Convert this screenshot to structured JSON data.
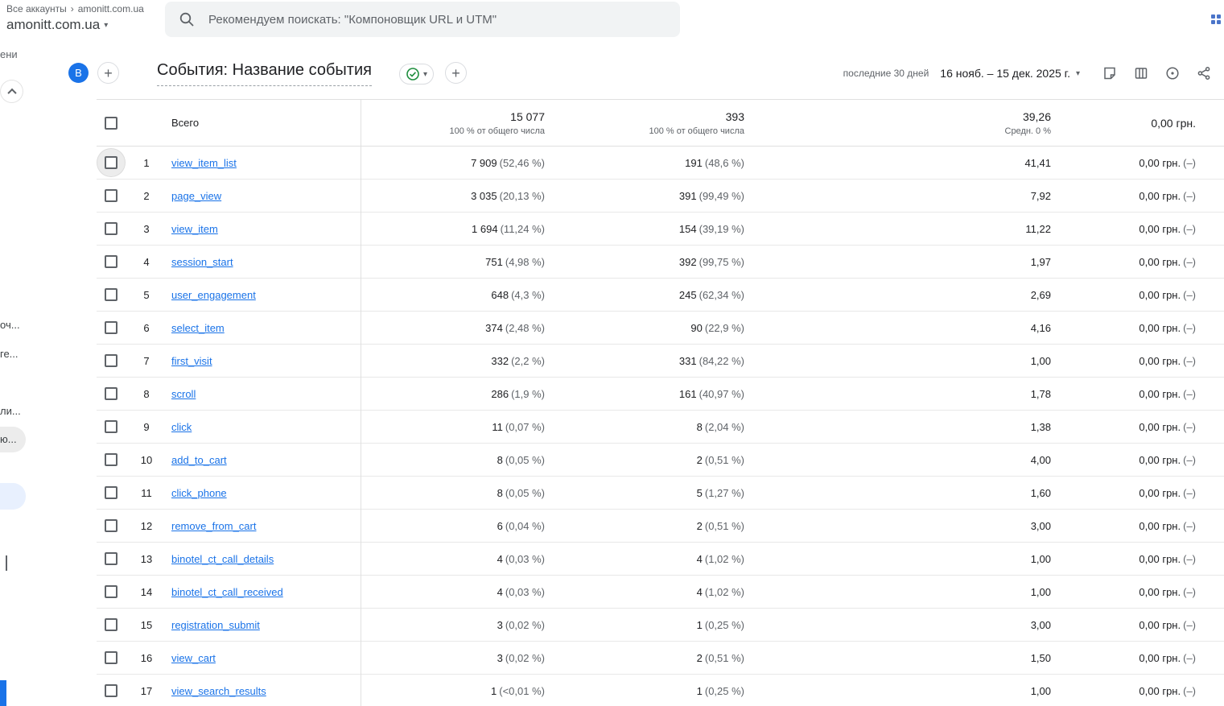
{
  "topbar": {
    "breadcrumb": {
      "root": "Все аккаунты",
      "current": "amonitt.com.ua"
    },
    "account_selector": "amonitt.com.ua",
    "search_placeholder": "Рекомендуем поискать: \"Компоновщик URL и UTM\""
  },
  "sidebar": {
    "fragments": [
      "ени",
      "оч...",
      "ге...",
      "ли...",
      "ю..."
    ]
  },
  "report_header": {
    "avatar_letter": "B",
    "title": "События: Название события",
    "date_range_label": "последние 30 дней",
    "date_range": "16 нояб. – 15 дек. 2025 г."
  },
  "table": {
    "totals": {
      "label": "Всего",
      "count": "15 077",
      "count_sub": "100 % от общего числа",
      "users": "393",
      "users_sub": "100 % от общего числа",
      "per_user": "39,26",
      "per_user_sub": "Средн. 0 %",
      "revenue": "0,00 грн."
    },
    "rows": [
      {
        "n": 1,
        "name": "view_item_list",
        "count": "7 909",
        "count_pct": "(52,46 %)",
        "users": "191",
        "users_pct": "(48,6 %)",
        "per_user": "41,41",
        "revenue": "0,00 грн.",
        "revenue_note": "(–)",
        "focused": true
      },
      {
        "n": 2,
        "name": "page_view",
        "count": "3 035",
        "count_pct": "(20,13 %)",
        "users": "391",
        "users_pct": "(99,49 %)",
        "per_user": "7,92",
        "revenue": "0,00 грн.",
        "revenue_note": "(–)"
      },
      {
        "n": 3,
        "name": "view_item",
        "count": "1 694",
        "count_pct": "(11,24 %)",
        "users": "154",
        "users_pct": "(39,19 %)",
        "per_user": "11,22",
        "revenue": "0,00 грн.",
        "revenue_note": "(–)"
      },
      {
        "n": 4,
        "name": "session_start",
        "count": "751",
        "count_pct": "(4,98 %)",
        "users": "392",
        "users_pct": "(99,75 %)",
        "per_user": "1,97",
        "revenue": "0,00 грн.",
        "revenue_note": "(–)"
      },
      {
        "n": 5,
        "name": "user_engagement",
        "count": "648",
        "count_pct": "(4,3 %)",
        "users": "245",
        "users_pct": "(62,34 %)",
        "per_user": "2,69",
        "revenue": "0,00 грн.",
        "revenue_note": "(–)"
      },
      {
        "n": 6,
        "name": "select_item",
        "count": "374",
        "count_pct": "(2,48 %)",
        "users": "90",
        "users_pct": "(22,9 %)",
        "per_user": "4,16",
        "revenue": "0,00 грн.",
        "revenue_note": "(–)"
      },
      {
        "n": 7,
        "name": "first_visit",
        "count": "332",
        "count_pct": "(2,2 %)",
        "users": "331",
        "users_pct": "(84,22 %)",
        "per_user": "1,00",
        "revenue": "0,00 грн.",
        "revenue_note": "(–)"
      },
      {
        "n": 8,
        "name": "scroll",
        "count": "286",
        "count_pct": "(1,9 %)",
        "users": "161",
        "users_pct": "(40,97 %)",
        "per_user": "1,78",
        "revenue": "0,00 грн.",
        "revenue_note": "(–)"
      },
      {
        "n": 9,
        "name": "click",
        "count": "11",
        "count_pct": "(0,07 %)",
        "users": "8",
        "users_pct": "(2,04 %)",
        "per_user": "1,38",
        "revenue": "0,00 грн.",
        "revenue_note": "(–)"
      },
      {
        "n": 10,
        "name": "add_to_cart",
        "count": "8",
        "count_pct": "(0,05 %)",
        "users": "2",
        "users_pct": "(0,51 %)",
        "per_user": "4,00",
        "revenue": "0,00 грн.",
        "revenue_note": "(–)"
      },
      {
        "n": 11,
        "name": "click_phone",
        "count": "8",
        "count_pct": "(0,05 %)",
        "users": "5",
        "users_pct": "(1,27 %)",
        "per_user": "1,60",
        "revenue": "0,00 грн.",
        "revenue_note": "(–)"
      },
      {
        "n": 12,
        "name": "remove_from_cart",
        "count": "6",
        "count_pct": "(0,04 %)",
        "users": "2",
        "users_pct": "(0,51 %)",
        "per_user": "3,00",
        "revenue": "0,00 грн.",
        "revenue_note": "(–)"
      },
      {
        "n": 13,
        "name": "binotel_ct_call_details",
        "count": "4",
        "count_pct": "(0,03 %)",
        "users": "4",
        "users_pct": "(1,02 %)",
        "per_user": "1,00",
        "revenue": "0,00 грн.",
        "revenue_note": "(–)"
      },
      {
        "n": 14,
        "name": "binotel_ct_call_received",
        "count": "4",
        "count_pct": "(0,03 %)",
        "users": "4",
        "users_pct": "(1,02 %)",
        "per_user": "1,00",
        "revenue": "0,00 грн.",
        "revenue_note": "(–)"
      },
      {
        "n": 15,
        "name": "registration_submit",
        "count": "3",
        "count_pct": "(0,02 %)",
        "users": "1",
        "users_pct": "(0,25 %)",
        "per_user": "3,00",
        "revenue": "0,00 грн.",
        "revenue_note": "(–)"
      },
      {
        "n": 16,
        "name": "view_cart",
        "count": "3",
        "count_pct": "(0,02 %)",
        "users": "2",
        "users_pct": "(0,51 %)",
        "per_user": "1,50",
        "revenue": "0,00 грн.",
        "revenue_note": "(–)"
      },
      {
        "n": 17,
        "name": "view_search_results",
        "count": "1",
        "count_pct": "(<0,01 %)",
        "users": "1",
        "users_pct": "(0,25 %)",
        "per_user": "1,00",
        "revenue": "0,00 грн.",
        "revenue_note": "(–)"
      }
    ]
  },
  "colors": {
    "accent_blue": "#1a73e8",
    "link_blue": "#1a73e8",
    "success_green": "#1e8e3e",
    "text_grey": "#5f6368",
    "border_grey": "#e0e0e0",
    "search_bg": "#f1f3f4"
  },
  "icons": [
    "search-icon",
    "apps-grid-icon",
    "chevron-down-icon",
    "add-icon",
    "check-circle-icon",
    "note-icon",
    "compare-icon",
    "insights-icon",
    "share-icon",
    "chevron-up-icon",
    "checkbox"
  ]
}
